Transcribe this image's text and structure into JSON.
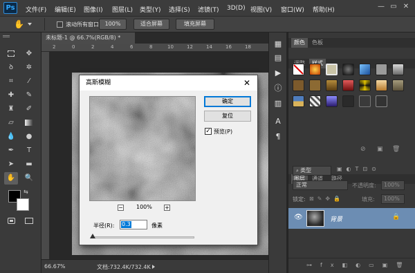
{
  "app": {
    "logo": "Ps"
  },
  "menus": [
    "文件(F)",
    "编辑(E)",
    "图像(I)",
    "图层(L)",
    "类型(Y)",
    "选择(S)",
    "滤镜(T)",
    "3D(D)",
    "视图(V)",
    "窗口(W)",
    "帮助(H)"
  ],
  "window_controls": {
    "minimize": "—",
    "restore": "▭",
    "close": "✕"
  },
  "options_bar": {
    "scroll_all_label": "滚动所有窗口",
    "zoom_value": "100%",
    "fit_screen_label": "适合屏幕",
    "fill_screen_label": "填充屏幕"
  },
  "document": {
    "tab_title": "未标题-1 @ 66.7%(RGB/8) *",
    "status_zoom": "66.67%",
    "status_doc": "文档:732.4K/732.4K",
    "ruler_marks": [
      "2",
      "0",
      "2",
      "4",
      "6",
      "8",
      "10",
      "12",
      "14",
      "16",
      "18"
    ]
  },
  "swatches_panel": {
    "tabs": [
      "颜色",
      "色板"
    ]
  },
  "styles_panel": {
    "tabs": [
      "调整",
      "样式"
    ]
  },
  "layers_panel": {
    "tabs": [
      "图层",
      "通道",
      "路径"
    ],
    "filter_kind": "类型",
    "blend_mode": "正常",
    "opacity_label": "不透明度:",
    "opacity_value": "100%",
    "lock_label": "锁定:",
    "fill_label": "填充:",
    "fill_value": "100%",
    "layer_name": "背景"
  },
  "dialog": {
    "title": "高斯模糊",
    "ok_label": "确定",
    "reset_label": "复位",
    "preview_label": "预览(P)",
    "preview_checked": true,
    "zoom_value": "100%",
    "radius_label": "半径(R):",
    "radius_value": "0.3",
    "radius_unit": "像素",
    "slider_level_fraction": 0.0
  },
  "colors": {
    "accent": "#0078d7",
    "selected_layer": "#6c8db3",
    "panel_bg": "#383838"
  }
}
